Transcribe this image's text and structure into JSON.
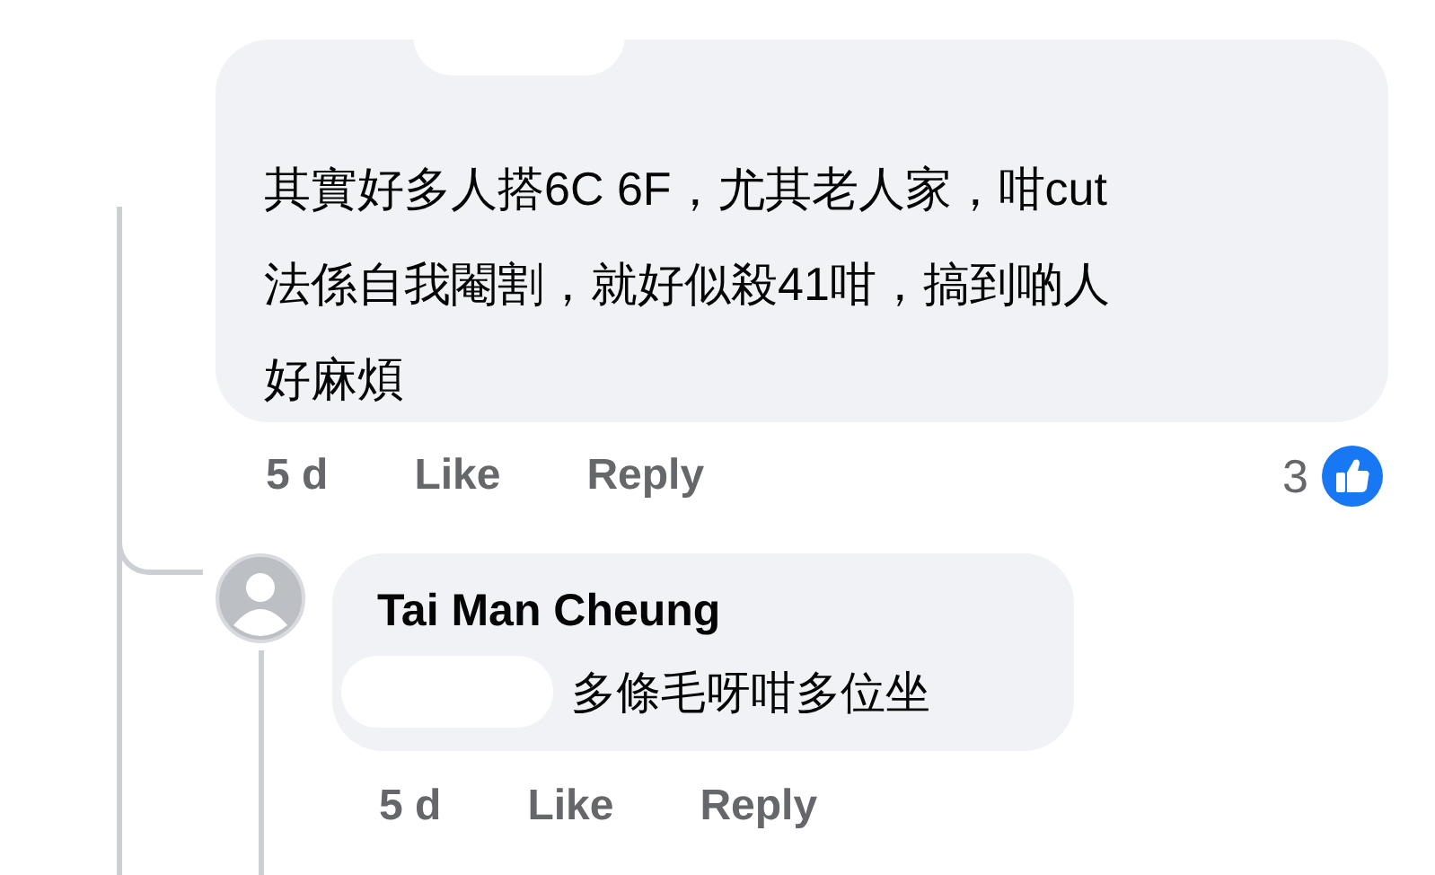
{
  "comment": {
    "text_lines": [
      "其實好多人搭6C 6F，尤其老人家，咁cut",
      "法係自我閹割，就好似殺41咁，搞到啲人",
      "好麻煩"
    ],
    "time": "5 d",
    "actions": [
      "Like",
      "Reply"
    ],
    "reaction_count": "3"
  },
  "reply": {
    "author": "Tai Man Cheung",
    "text": "多條毛呀咁多位坐",
    "time": "5 d",
    "actions": [
      "Like",
      "Reply"
    ]
  }
}
